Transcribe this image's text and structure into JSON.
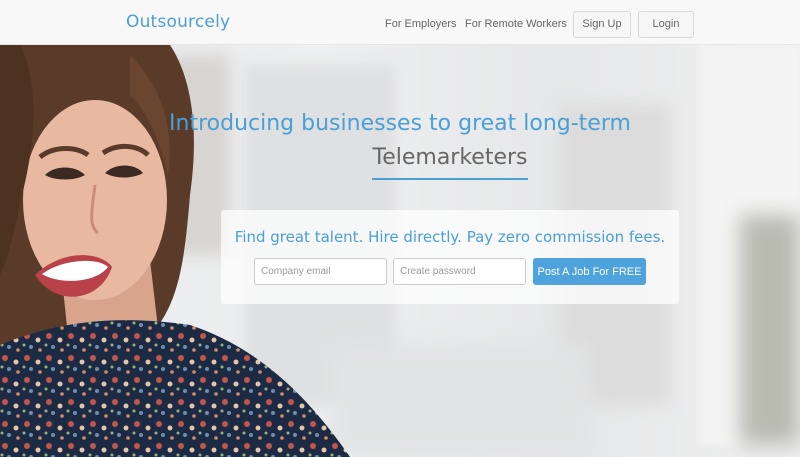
{
  "header": {
    "brand": "Outsourcely",
    "nav": {
      "employers": "For Employers",
      "remote_workers": "For Remote Workers",
      "sign_up": "Sign Up",
      "login": "Login"
    }
  },
  "hero": {
    "headline": "Introducing businesses to great long-term",
    "role": "Telemarketers",
    "tagline": "Find great talent. Hire directly. Pay zero commission fees.",
    "form": {
      "email_placeholder": "Company email",
      "password_placeholder": "Create password",
      "cta_label": "Post A Job For FREE"
    },
    "photo": "smiling-woman-photo"
  },
  "colors": {
    "accent": "#4a9fd6",
    "cta": "#4fa3dc",
    "nav_text": "#666666",
    "header_bg": "#f8f8f8"
  }
}
